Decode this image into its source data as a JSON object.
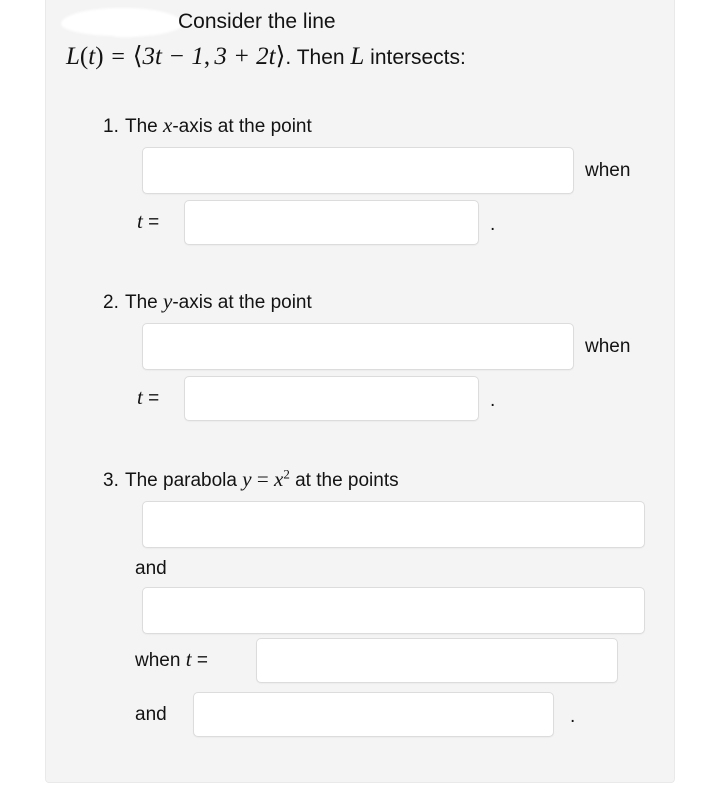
{
  "page": {
    "background_color": "#ffffff",
    "card_background_color": "#f4f4f4",
    "input_background_color": "#ffffff",
    "input_border_color": "#dcdcdc",
    "text_color": "#131313"
  },
  "prompt": {
    "line1": "Consider the line",
    "function_name": "L",
    "function_arg": "t",
    "equals": "=",
    "vector_open": "⟨",
    "component_1": "3t − 1",
    "component_separator": ",",
    "component_2": "3 + 2t",
    "vector_close": "⟩",
    "line2_tail": ". Then",
    "line_label": "L",
    "line2_end": "intersects:",
    "redaction_note": "white-scribble-redaction"
  },
  "items": [
    {
      "number": "1.",
      "text_before": "The",
      "variable": "x",
      "text_after": "-axis at the point",
      "point_input": {
        "value": "",
        "placeholder": ""
      },
      "when_label": "when",
      "t_label": "t",
      "t_equals": "=",
      "t_input": {
        "value": "",
        "placeholder": ""
      },
      "period": "."
    },
    {
      "number": "2.",
      "text_before": "The",
      "variable": "y",
      "text_after": "-axis at the point",
      "point_input": {
        "value": "",
        "placeholder": ""
      },
      "when_label": "when",
      "t_label": "t",
      "t_equals": "=",
      "t_input": {
        "value": "",
        "placeholder": ""
      },
      "period": "."
    }
  ],
  "item3": {
    "number": "3.",
    "text_before": "The parabola",
    "eq_lhs": "y",
    "eq_sign": "=",
    "eq_rhs_base": "x",
    "eq_rhs_exponent": "2",
    "text_after": "at the points",
    "point_input_1": {
      "value": "",
      "placeholder": ""
    },
    "and_label_1": "and",
    "point_input_2": {
      "value": "",
      "placeholder": ""
    },
    "when_label": "when",
    "t_label": "t",
    "t_equals": "=",
    "t_input_1": {
      "value": "",
      "placeholder": ""
    },
    "and_label_2": "and",
    "t_input_2": {
      "value": "",
      "placeholder": ""
    },
    "period": "."
  }
}
